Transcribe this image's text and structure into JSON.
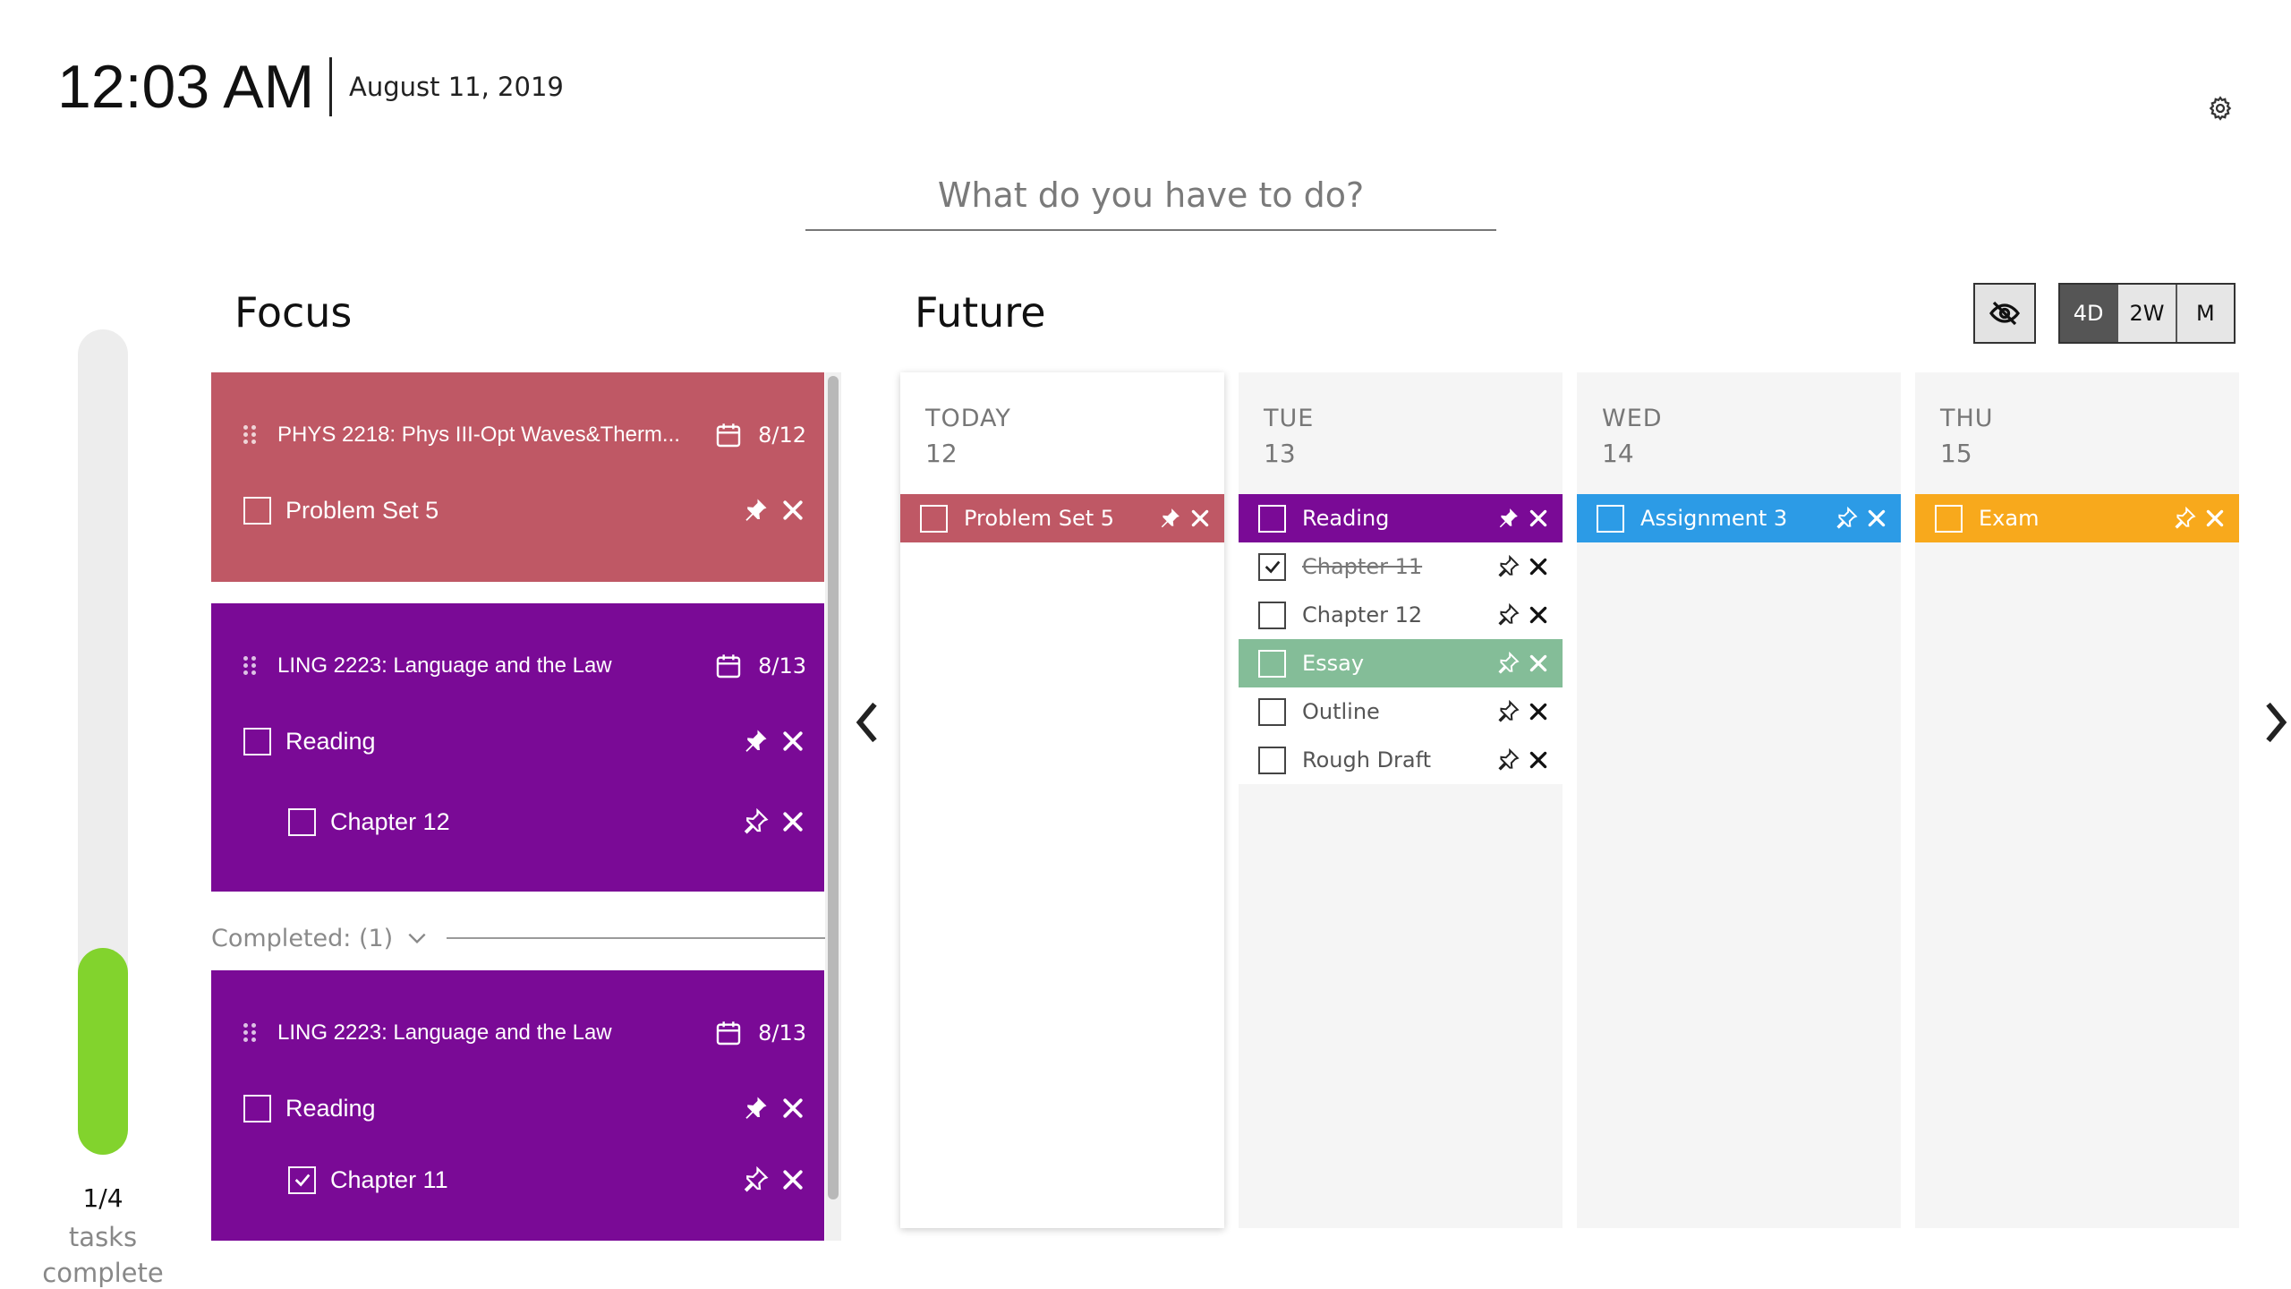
{
  "header": {
    "time": "12:03 AM",
    "date": "August 11, 2019"
  },
  "add_task": {
    "placeholder": "What do you have to do?"
  },
  "progress": {
    "count": "1/4",
    "label_line1": "tasks",
    "label_line2": "complete",
    "fraction": 0.25,
    "color": "#82d32d"
  },
  "focus": {
    "title": "Focus",
    "cards": [
      {
        "course": "PHYS 2218: Phys III-Opt Waves&Therm...",
        "due": "8/12",
        "color": "#bf5865",
        "tasks": [
          {
            "label": "Problem Set 5",
            "checked": false,
            "pinned": true,
            "level": 0
          }
        ]
      },
      {
        "course": "LING 2223: Language and the Law",
        "due": "8/13",
        "color": "#7a0a96",
        "tasks": [
          {
            "label": "Reading",
            "checked": false,
            "pinned": true,
            "level": 0
          },
          {
            "label": "Chapter 12",
            "checked": false,
            "pinned": false,
            "level": 1
          }
        ]
      }
    ],
    "completed_label": "Completed: (1)",
    "completed_cards": [
      {
        "course": "LING 2223: Language and the Law",
        "due": "8/13",
        "color": "#7a0a96",
        "tasks": [
          {
            "label": "Reading",
            "checked": false,
            "pinned": true,
            "level": 0
          },
          {
            "label": "Chapter 11",
            "checked": true,
            "pinned": false,
            "level": 1
          }
        ]
      }
    ]
  },
  "future": {
    "title": "Future",
    "view_options": [
      "4D",
      "2W",
      "M"
    ],
    "selected_view": "4D",
    "days": [
      {
        "name": "TODAY",
        "num": "12",
        "tasks": [
          {
            "label": "Problem Set 5",
            "color": "#bf5865",
            "checked": false,
            "pinned": true
          }
        ]
      },
      {
        "name": "TUE",
        "num": "13",
        "tasks": [
          {
            "label": "Reading",
            "color": "#7a0a96",
            "checked": false,
            "pinned": true
          },
          {
            "label": "Chapter 11",
            "color": "",
            "checked": true,
            "pinned": false
          },
          {
            "label": "Chapter 12",
            "color": "",
            "checked": false,
            "pinned": false
          },
          {
            "label": "Essay",
            "color": "#84bd98",
            "checked": false,
            "pinned": false
          },
          {
            "label": "Outline",
            "color": "",
            "checked": false,
            "pinned": false
          },
          {
            "label": "Rough Draft",
            "color": "",
            "checked": false,
            "pinned": false
          }
        ]
      },
      {
        "name": "WED",
        "num": "14",
        "tasks": [
          {
            "label": "Assignment 3",
            "color": "#2c9be6",
            "checked": false,
            "pinned": false
          }
        ]
      },
      {
        "name": "THU",
        "num": "15",
        "tasks": [
          {
            "label": "Exam",
            "color": "#f8a91c",
            "checked": false,
            "pinned": false
          }
        ]
      }
    ]
  }
}
